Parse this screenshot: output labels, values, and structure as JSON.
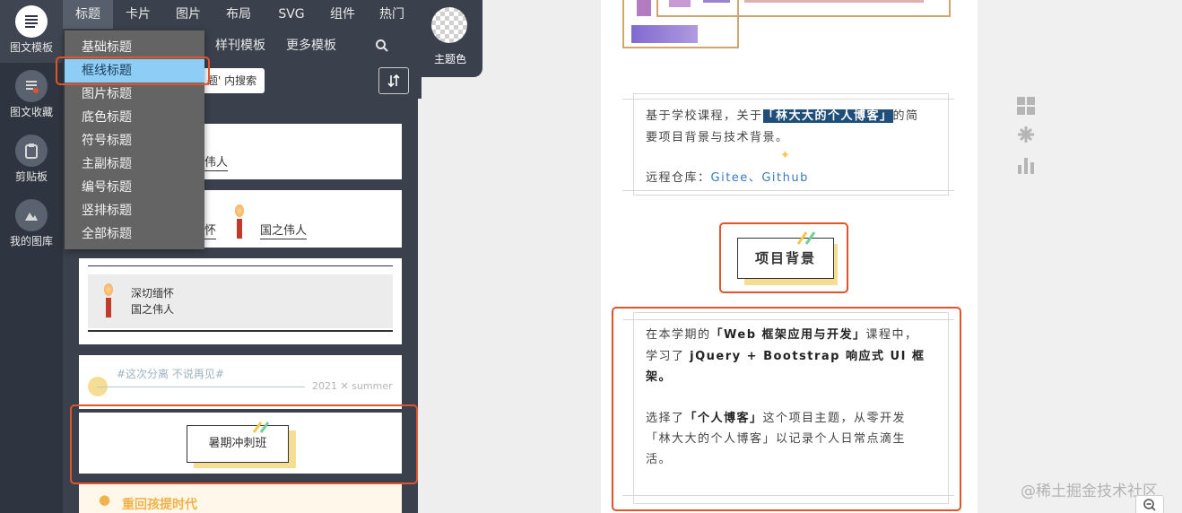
{
  "leftnav": {
    "items": [
      {
        "label": "图文模板",
        "icon": "document-lines-icon"
      },
      {
        "label": "图文收藏",
        "icon": "bookmark-list-icon"
      },
      {
        "label": "剪贴板",
        "icon": "clipboard-icon"
      },
      {
        "label": "我的图库",
        "icon": "image-gallery-icon"
      }
    ]
  },
  "tabs": [
    "标题",
    "卡片",
    "图片",
    "布局",
    "SVG",
    "组件",
    "热门"
  ],
  "subtabs": {
    "journal": "样刊模板",
    "more": "更多模板"
  },
  "search": {
    "hint": "题' 内搜索"
  },
  "theme": {
    "label": "主题色"
  },
  "menu": {
    "items": [
      "基础标题",
      "框线标题",
      "图片标题",
      "底色标题",
      "符号标题",
      "主副标题",
      "编号标题",
      "竖排标题",
      "全部标题"
    ]
  },
  "panel": {
    "card1": {
      "text": "伟人"
    },
    "card2": {
      "left": "怀",
      "right": "国之伟人"
    },
    "card3": {
      "line1": "深切缅怀",
      "line2": "国之伟人"
    },
    "card4": {
      "tag": "#这次分离 不说再见#",
      "date": "2021 ✕ summer"
    },
    "card5": {
      "title": "暑期冲刺班"
    },
    "card6": {
      "title": "重回孩提时代"
    }
  },
  "preview": {
    "intro": {
      "prefix": "基于学校课程，关于",
      "highlight": "「林大大的个人博客」",
      "suffix": "的简",
      "line2": "要项目背景与技术背景。",
      "repo_label": "远程仓库：",
      "gitee": "Gitee",
      "sep": "、",
      "github": "Github"
    },
    "section_title": "项目背景",
    "body": {
      "l1a": "在本学期的",
      "l1b": "「Web 框架应用与开发」",
      "l1c": "课程中，",
      "l2a": "学习了",
      "l2b": "jQuery + Bootstrap 响应式 UI 框",
      "l3": "架。",
      "l4a": "选择了",
      "l4b": "「个人博客」",
      "l4c": "这个项目主题，从零开发",
      "l5": "「林大大的个人博客」以记录个人日常点滴生",
      "l6": "活。"
    }
  },
  "watermark": "@稀土掘金技术社区",
  "colors": {
    "accent_red": "#e0542b",
    "menu_selected": "#8ecdf5",
    "highlight_bg": "#1f4e79",
    "link": "#3a7bbf"
  }
}
